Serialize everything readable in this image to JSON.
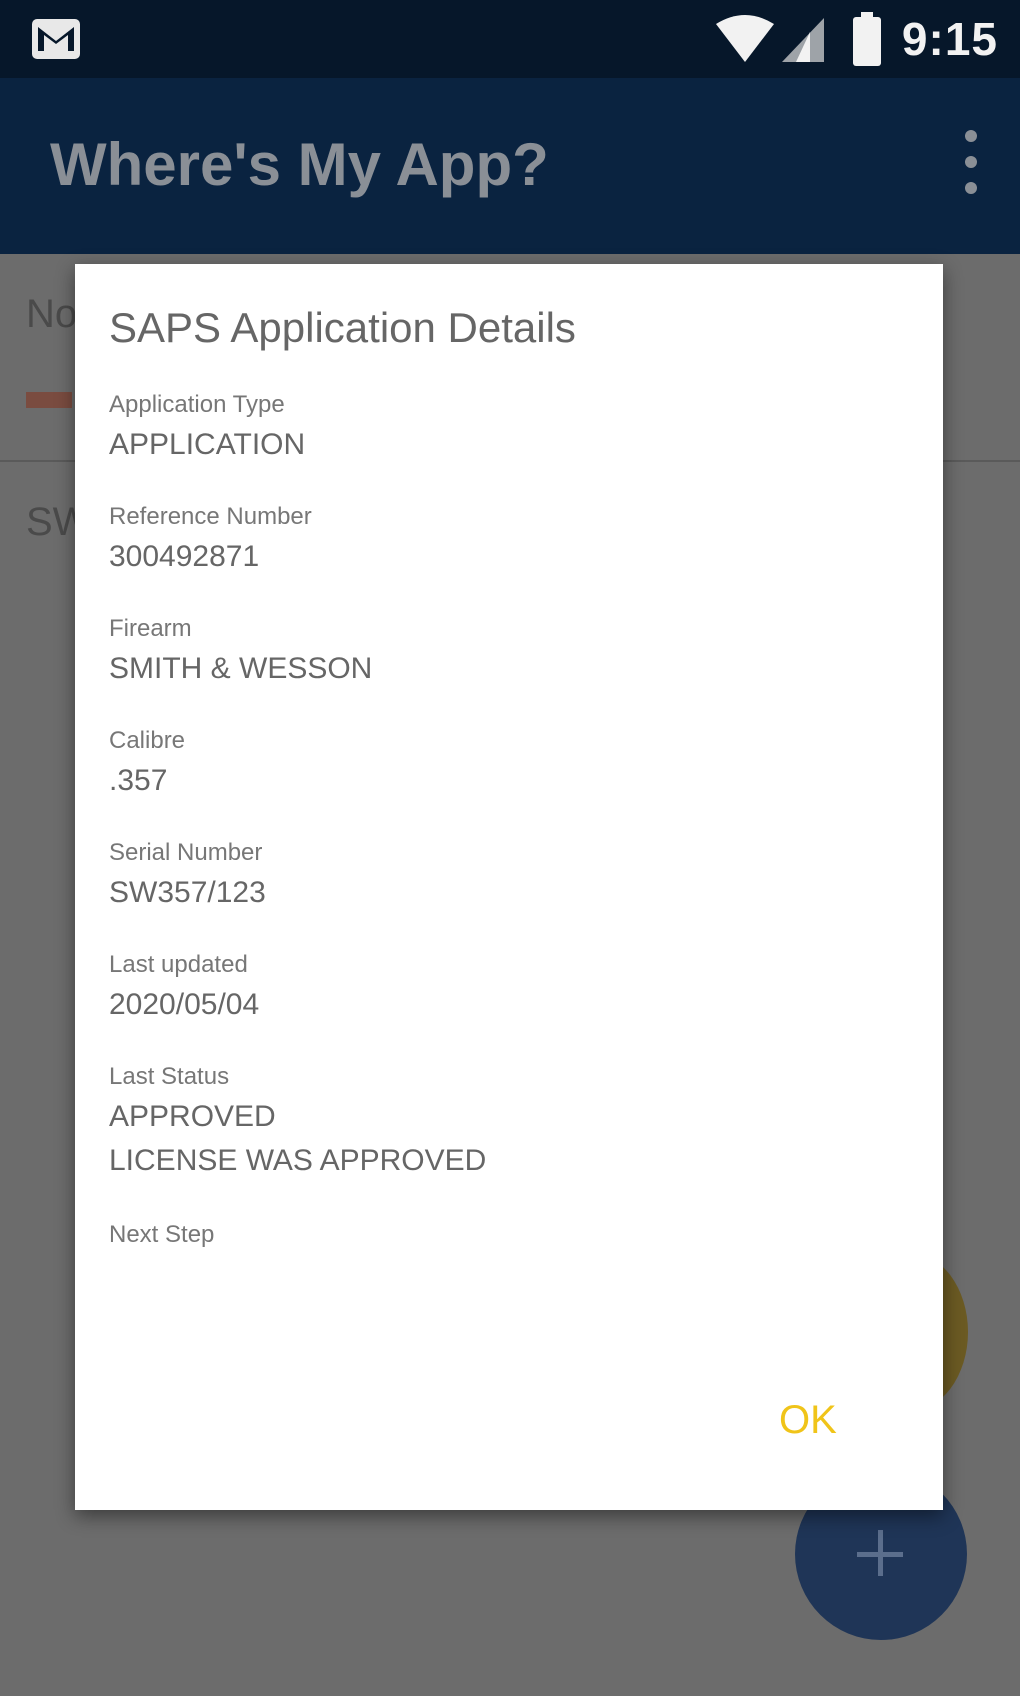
{
  "status_bar": {
    "time": "9:15",
    "icons": [
      "gmail-notification-icon",
      "wifi-icon",
      "cell-signal-icon",
      "battery-icon"
    ]
  },
  "app_bar": {
    "title": "Where's My App?",
    "menu_icon": "overflow-menu-icon"
  },
  "background": {
    "item1_title": "No",
    "item2_title": "SW",
    "fab_icon": "plus-icon"
  },
  "dialog": {
    "title": "SAPS Application Details",
    "fields": [
      {
        "label": "Application Type",
        "values": [
          "APPLICATION"
        ]
      },
      {
        "label": "Reference Number",
        "values": [
          "300492871"
        ]
      },
      {
        "label": "Firearm",
        "values": [
          "SMITH & WESSON"
        ]
      },
      {
        "label": "Calibre",
        "values": [
          ".357"
        ]
      },
      {
        "label": "Serial Number",
        "values": [
          "SW357/123"
        ]
      },
      {
        "label": "Last updated",
        "values": [
          "2020/05/04"
        ]
      },
      {
        "label": "Last Status",
        "values": [
          "APPROVED",
          "LICENSE WAS APPROVED"
        ]
      },
      {
        "label": "Next Step",
        "values": []
      }
    ],
    "ok_label": "OK"
  },
  "colors": {
    "status_bar": "#06172a",
    "app_bar": "#0a2340",
    "accent": "#f0c419",
    "fab": "#1f3557"
  }
}
